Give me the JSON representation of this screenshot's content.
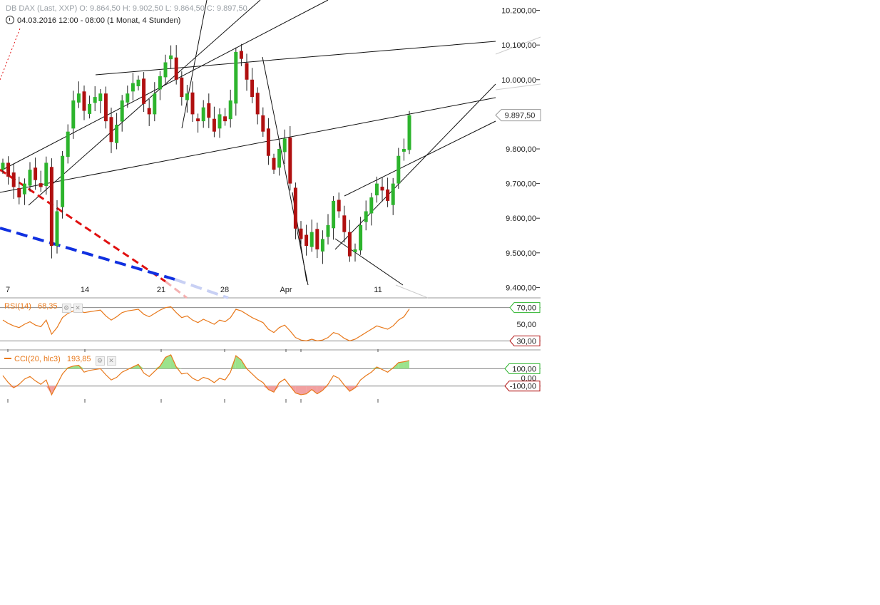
{
  "header": {
    "instrument_line": "DB DAX (Last, XXP)  O: 9.864,50  H: 9.902,50  L: 9.864,50  C: 9.897,50",
    "date_line": "04.03.2016 12:00 - 08:00 (1 Monat, 4 Stunden)"
  },
  "colors": {
    "up": "#2db42d",
    "down": "#b01010",
    "indicator": "#e8781a",
    "ma_red": "#e01010",
    "ma_blue": "#1030e0"
  },
  "chart_data": [
    {
      "type": "candlestick",
      "title": "DB DAX",
      "x_tick_labels": [
        "7",
        "14",
        "21",
        "28",
        "Apr",
        "11"
      ],
      "y_tick_labels": [
        "10.200,00",
        "10.100,00",
        "10.000,00",
        "9.800,00",
        "9.700,00",
        "9.600,00",
        "9.500,00",
        "9.400,00"
      ],
      "ylim": [
        9370,
        10230
      ],
      "last_price_label": "9.897,50",
      "close_series": [
        9760,
        9720,
        9690,
        9660,
        9700,
        9740,
        9710,
        9690,
        9760,
        9520,
        9620,
        9780,
        9850,
        9940,
        9960,
        9910,
        9930,
        9950,
        9960,
        9880,
        9820,
        9870,
        9940,
        9960,
        9990,
        10000,
        9930,
        9900,
        9960,
        10010,
        10050,
        10070,
        10000,
        9950,
        9960,
        9900,
        9880,
        9920,
        9890,
        9850,
        9900,
        9880,
        9940,
        10080,
        10060,
        10000,
        9950,
        9900,
        9850,
        9780,
        9740,
        9800,
        9830,
        9700,
        9570,
        9540,
        9520,
        9560,
        9510,
        9540,
        9580,
        9650,
        9620,
        9560,
        9490,
        9510,
        9580,
        9620,
        9660,
        9700,
        9680,
        9650,
        9700,
        9780,
        9800,
        9897.5
      ]
    },
    {
      "type": "line",
      "title": "RSI(14)",
      "value_label": "68,35",
      "y_tick_labels": [
        "70,00",
        "50,00",
        "30,00"
      ],
      "ylim": [
        20,
        80
      ],
      "values": [
        55,
        51,
        48,
        46,
        50,
        53,
        49,
        47,
        55,
        38,
        46,
        58,
        63,
        66,
        67,
        64,
        65,
        66,
        67,
        60,
        55,
        59,
        64,
        66,
        67,
        68,
        62,
        59,
        63,
        67,
        70,
        71,
        64,
        58,
        60,
        55,
        52,
        56,
        53,
        50,
        55,
        53,
        58,
        68,
        66,
        62,
        58,
        55,
        52,
        44,
        40,
        46,
        49,
        42,
        34,
        31,
        30,
        32,
        30,
        31,
        34,
        40,
        38,
        33,
        30,
        32,
        36,
        40,
        44,
        48,
        46,
        44,
        48,
        55,
        59,
        68.35
      ]
    },
    {
      "type": "area",
      "title": "CCI(20, hlc3)",
      "value_label": "193,85",
      "y_tick_labels": [
        "100,00",
        "0,00",
        "-100,00"
      ],
      "ylim": [
        -250,
        300
      ],
      "values": [
        20,
        -60,
        -120,
        -80,
        -20,
        10,
        -40,
        -80,
        -30,
        -200,
        -80,
        40,
        110,
        130,
        140,
        60,
        80,
        90,
        100,
        30,
        -30,
        0,
        60,
        90,
        120,
        150,
        50,
        10,
        70,
        130,
        230,
        260,
        120,
        40,
        50,
        -10,
        -40,
        0,
        -20,
        -60,
        -10,
        -30,
        60,
        250,
        200,
        100,
        40,
        -20,
        -60,
        -140,
        -170,
        -60,
        -20,
        -100,
        -180,
        -200,
        -190,
        -140,
        -190,
        -150,
        -80,
        20,
        -10,
        -90,
        -160,
        -120,
        -30,
        20,
        60,
        120,
        90,
        60,
        110,
        170,
        180,
        193.85
      ]
    }
  ]
}
